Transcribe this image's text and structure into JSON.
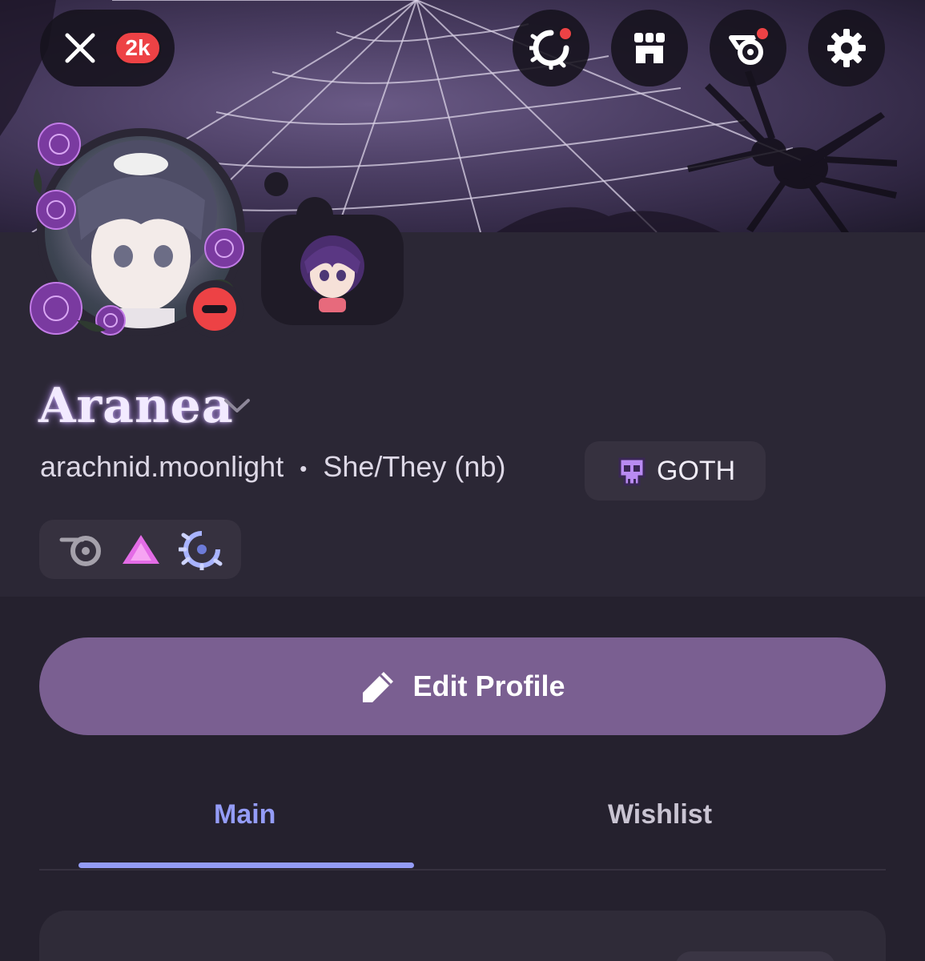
{
  "header": {
    "close_icon": "close-icon",
    "notification_count": "2k",
    "buttons": [
      {
        "name": "nitro-laurel-icon",
        "has_dot": true
      },
      {
        "name": "shop-icon",
        "has_dot": false
      },
      {
        "name": "quest-icon",
        "has_dot": true
      },
      {
        "name": "gear-icon",
        "has_dot": false
      }
    ]
  },
  "profile": {
    "display_name": "Aranea",
    "username": "arachnid.moonlight",
    "separator": "•",
    "pronouns": "She/They (nb)",
    "status": "do-not-disturb",
    "tag": {
      "icon": "skull-icon",
      "label": "GOTH"
    },
    "badges": [
      "hypesquad-orbit-icon",
      "triangle-badge-icon",
      "nitro-laurel-badge-icon"
    ]
  },
  "actions": {
    "edit_label": "Edit Profile",
    "edit_icon": "pencil-icon"
  },
  "tabs": [
    {
      "label": "Main",
      "active": true
    },
    {
      "label": "Wishlist",
      "active": false
    }
  ],
  "colors": {
    "background": "#25212e",
    "panel": "#2b2735",
    "accent": "#949cf7",
    "button": "#7a5f91",
    "danger": "#ed4245",
    "tag_bg": "#36313f"
  }
}
